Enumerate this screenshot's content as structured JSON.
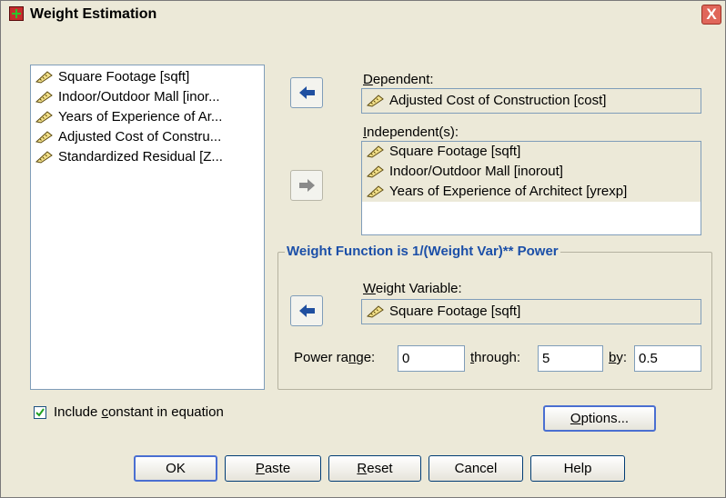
{
  "window": {
    "title": "Weight Estimation",
    "close_label": "X"
  },
  "source_list": [
    "Square Footage [sqft]",
    "Indoor/Outdoor Mall [inor...",
    "Years of Experience of Ar...",
    "Adjusted Cost of Constru...",
    "Standardized Residual [Z..."
  ],
  "dependent": {
    "label_prefix": "",
    "label_hot": "D",
    "label_rest": "ependent:",
    "value": "Adjusted Cost of Construction [cost]"
  },
  "independents": {
    "label_hot": "I",
    "label_rest": "ndependent(s):",
    "items": [
      "Square Footage [sqft]",
      "Indoor/Outdoor Mall [inorout]",
      "Years of Experience of Architect [yrexp]"
    ]
  },
  "weight_group": {
    "title": "Weight Function is 1/(Weight Var)** Power",
    "weight_label_hot": "W",
    "weight_label_rest": "eight Variable:",
    "weight_value": "Square Footage [sqft]",
    "power_label_pre": "Power ra",
    "power_label_hot": "n",
    "power_label_post": "ge:",
    "power_from": "0",
    "through_label_hot": "t",
    "through_label_rest": "hrough:",
    "power_to": "5",
    "by_label_hot": "b",
    "by_label_rest": "y:",
    "power_by": "0.5"
  },
  "include_constant": {
    "label_pre": "Include ",
    "label_hot": "c",
    "label_post": "onstant in equation",
    "checked": true
  },
  "buttons": {
    "options_hot": "O",
    "options_rest": "ptions...",
    "ok": "OK",
    "paste_hot": "P",
    "paste_rest": "aste",
    "reset_hot": "R",
    "reset_rest": "eset",
    "cancel": "Cancel",
    "help": "Help"
  },
  "colors": {
    "dialog_bg": "#ECE9D8",
    "group_title": "#1B4FA8",
    "arrow_active": "#1F4FA0",
    "arrow_disabled": "#8A8A8A"
  },
  "icons": {
    "variable": "ruler-scale-icon",
    "move_left": "arrow-left-icon",
    "move_right": "arrow-right-icon"
  }
}
